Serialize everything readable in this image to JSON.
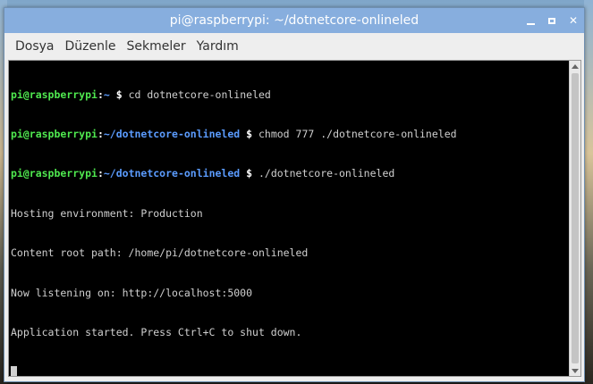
{
  "window": {
    "title": "pi@raspberrypi: ~/dotnetcore-onlineled",
    "controls": {
      "minimize_icon": "minimize-icon",
      "maximize_icon": "maximize-icon",
      "close_icon": "close-icon"
    }
  },
  "menu": {
    "items": [
      {
        "label": "Dosya"
      },
      {
        "label": "Düzenle"
      },
      {
        "label": "Sekmeler"
      },
      {
        "label": "Yardım"
      }
    ]
  },
  "terminal": {
    "lines": [
      {
        "user": "pi@raspberrypi",
        "sep": ":",
        "path": "~",
        "prompt": " $ ",
        "cmd": "cd dotnetcore-onlineled"
      },
      {
        "user": "pi@raspberrypi",
        "sep": ":",
        "path": "~/dotnetcore-onlineled",
        "prompt": " $ ",
        "cmd": "chmod 777 ./dotnetcore-onlineled"
      },
      {
        "user": "pi@raspberrypi",
        "sep": ":",
        "path": "~/dotnetcore-onlineled",
        "prompt": " $ ",
        "cmd": "./dotnetcore-onlineled"
      }
    ],
    "output": [
      "Hosting environment: Production",
      "Content root path: /home/pi/dotnetcore-onlineled",
      "Now listening on: http://localhost:5000",
      "Application started. Press Ctrl+C to shut down."
    ]
  },
  "colors": {
    "titlebar": "#87aede",
    "user": "#4fe84f",
    "path": "#5b9cff",
    "text": "#d0d0d0",
    "background": "#000000"
  }
}
